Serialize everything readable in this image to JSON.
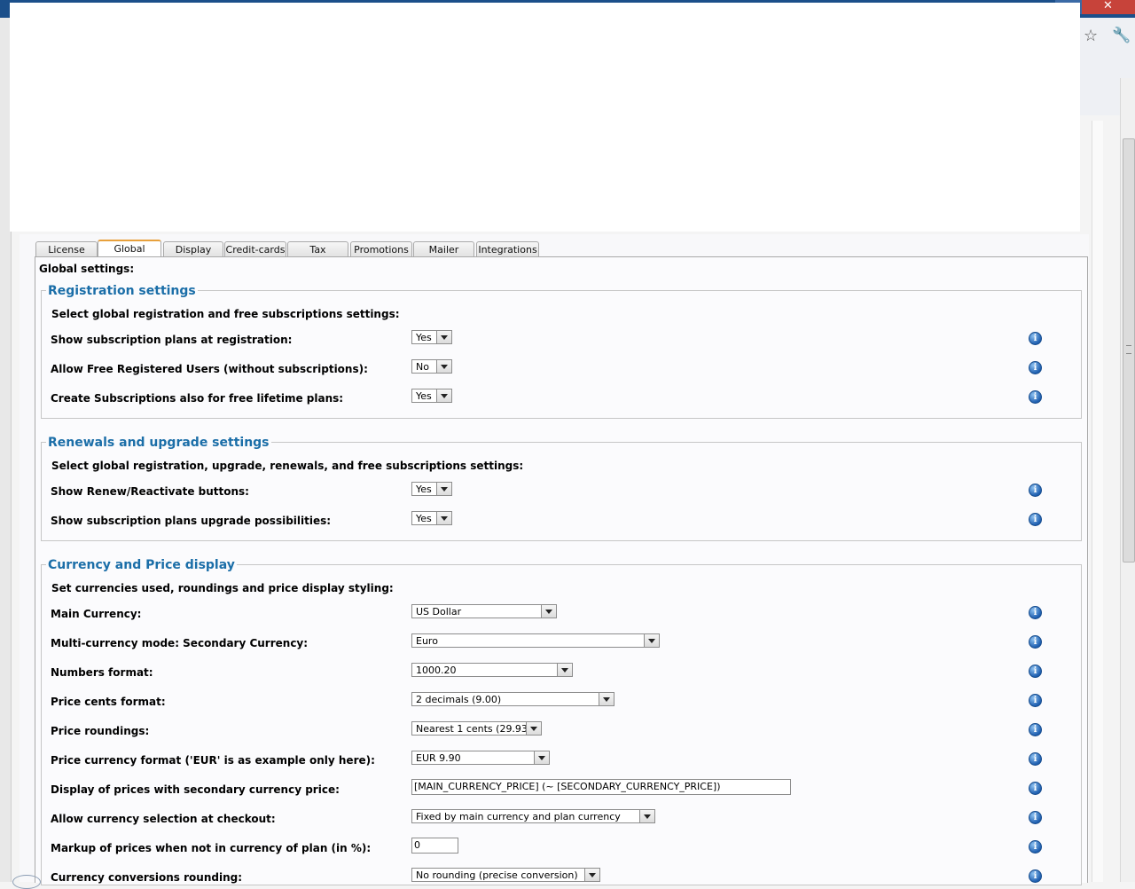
{
  "tabs": [
    {
      "label": "License",
      "active": false
    },
    {
      "label": "Global",
      "active": true
    },
    {
      "label": "Display",
      "active": false
    },
    {
      "label": "Credit-cards",
      "active": false
    },
    {
      "label": "Tax",
      "active": false
    },
    {
      "label": "Promotions",
      "active": false
    },
    {
      "label": "Mailer",
      "active": false
    },
    {
      "label": "Integrations",
      "active": false
    }
  ],
  "panel_title": "Global settings:",
  "registration": {
    "legend": "Registration settings",
    "description": "Select global registration and free subscriptions settings:",
    "rows": [
      {
        "label": "Show subscription plans at registration:",
        "value": "Yes"
      },
      {
        "label": "Allow Free Registered Users (without subscriptions):",
        "value": "No"
      },
      {
        "label": "Create Subscriptions also for free lifetime plans:",
        "value": "Yes"
      }
    ]
  },
  "renewals": {
    "legend": "Renewals and upgrade settings",
    "description": "Select global registration, upgrade, renewals, and free subscriptions settings:",
    "rows": [
      {
        "label": "Show Renew/Reactivate buttons:",
        "value": "Yes"
      },
      {
        "label": "Show subscription plans upgrade possibilities:",
        "value": "Yes"
      }
    ]
  },
  "currency": {
    "legend": "Currency and Price display",
    "description": "Set currencies used, roundings and price display styling:",
    "rows": [
      {
        "label": "Main Currency:",
        "value": "US Dollar"
      },
      {
        "label": "Multi-currency mode: Secondary Currency:",
        "value": "Euro"
      },
      {
        "label": "Numbers format:",
        "value": "1000.20"
      },
      {
        "label": "Price cents format:",
        "value": "2 decimals (9.00)"
      },
      {
        "label": "Price roundings:",
        "value": "Nearest 1 cents (29.93)"
      },
      {
        "label": "Price currency format ('EUR' is as example only here):",
        "value": "EUR 9.90"
      },
      {
        "label": "Display of prices with secondary currency price:",
        "value": "[MAIN_CURRENCY_PRICE] (~ [SECONDARY_CURRENCY_PRICE])"
      },
      {
        "label": "Allow currency selection at checkout:",
        "value": "Fixed by main currency and plan currency"
      },
      {
        "label": "Markup of prices when not in currency of plan (in %):",
        "value": "0"
      },
      {
        "label": "Currency conversions rounding:",
        "value": "No rounding (precise conversion)"
      }
    ]
  },
  "icons": {
    "info": "i",
    "star": "☆",
    "wrench": "🔧",
    "close": "✕"
  }
}
